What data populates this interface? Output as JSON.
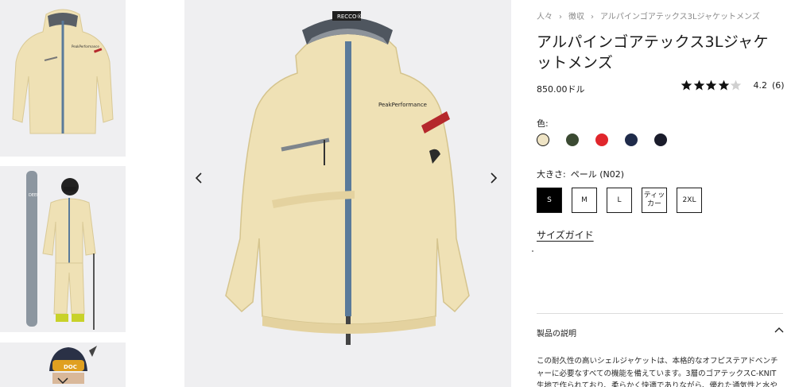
{
  "breadcrumb": [
    "人々",
    "徴収",
    "アルパインゴアテックス3Lジャケットメンズ"
  ],
  "product": {
    "title": "アルパインゴアテックス3Lジャケットメンズ",
    "price": "850.00ドル",
    "rating": {
      "stars": 4,
      "max": 5,
      "value": "4.2",
      "count": "(6)"
    }
  },
  "colors": {
    "label": "色:",
    "swatches": [
      {
        "name": "beige",
        "hex": "#efe4c5",
        "selected": true
      },
      {
        "name": "olive",
        "hex": "#3b4a32",
        "selected": false
      },
      {
        "name": "red",
        "hex": "#e0262c",
        "selected": false
      },
      {
        "name": "navy",
        "hex": "#1f2b4a",
        "selected": false
      },
      {
        "name": "dark-navy",
        "hex": "#1a1c2b",
        "selected": false
      }
    ]
  },
  "size": {
    "label": "大きさ:",
    "selected_color_name": "ペール (N02)",
    "options": [
      {
        "label": "S",
        "active": true
      },
      {
        "label": "M",
        "active": false
      },
      {
        "label": "L",
        "active": false
      },
      {
        "label": "ティッカー",
        "active": false
      },
      {
        "label": "2XL",
        "active": false
      }
    ],
    "guide_link": "サイズガイド"
  },
  "description": {
    "header": "製品の説明",
    "text": "この耐久性の高いシェルジャケットは、本格的なオフピステアドベンチャーに必要なすべての機能を備えています。3層のゴアテックスC-KNIT生地で作られており、柔らかく快適でありながら、優れた通気性と水や風から"
  },
  "jacket": {
    "brand_text": "PeakPerformance",
    "tag_text": "RECCO®"
  },
  "thumb_text": {
    "skis": "DEEP",
    "helmet": "DOC"
  },
  "icons": {
    "prev": "chevron-left-icon",
    "next": "chevron-right-icon",
    "thumbs_down": "chevron-down-icon",
    "collapse": "chevron-up-icon"
  },
  "palette": {
    "background": "#efeff1",
    "jacket": "#efe1b5",
    "zipper": "#5a7a9a",
    "accent_red": "#b5282c",
    "text": "#1a1a1a"
  }
}
